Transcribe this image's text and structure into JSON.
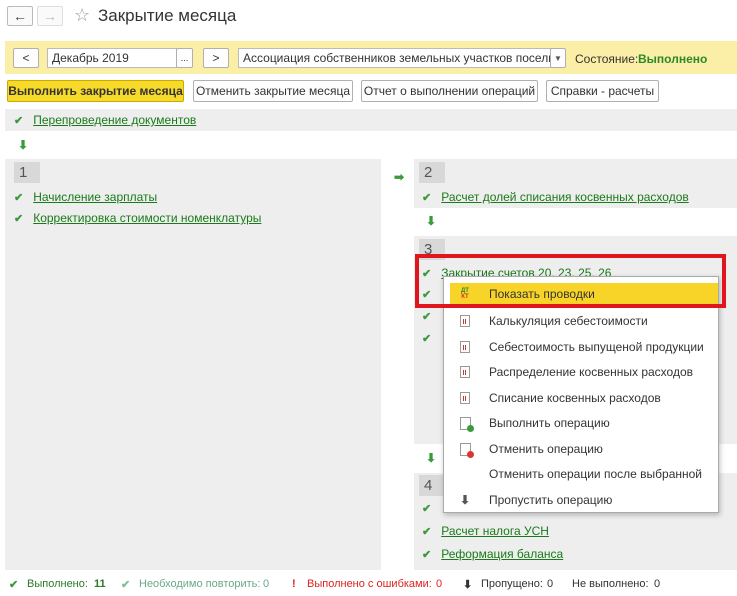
{
  "header": {
    "back_icon": "←",
    "forward_icon": "→",
    "star_icon": "☆",
    "title": "Закрытие месяца"
  },
  "toolbar": {
    "prev_label": "<",
    "period": "Декабрь 2019",
    "ellipsis": "...",
    "next_label": ">",
    "organization": "Ассоциация собственников земельных участков поселка Мел",
    "state_label": "Состояние:",
    "state_value": "Выполнено",
    "state_color": "#2a8a2a"
  },
  "actions": {
    "run": "Выполнить закрытие месяца",
    "cancel": "Отменить закрытие месяца",
    "report": "Отчет о выполнении операций",
    "refs": "Справки - расчеты"
  },
  "pre": {
    "label": "Перепроведение документов"
  },
  "stage1": {
    "num": "1",
    "items": [
      "Начисление зарплаты",
      "Корректировка стоимости номенклатуры"
    ]
  },
  "stage2": {
    "num": "2",
    "items": [
      "Расчет долей списания косвенных расходов"
    ]
  },
  "stage3": {
    "num": "3",
    "items": [
      "Закрытие счетов 20, 23, 25, 26"
    ]
  },
  "stage4": {
    "num": "4",
    "items": [
      "Расчет налога УСН",
      "Реформация баланса"
    ]
  },
  "menu": {
    "items": [
      {
        "label": "Показать проводки",
        "icon": "dt-kt-icon"
      },
      {
        "label": "Калькуляция себестоимости",
        "icon": "report-icon"
      },
      {
        "label": "Себестоимость выпущеной продукции",
        "icon": "report-icon"
      },
      {
        "label": "Распределение косвенных расходов",
        "icon": "report-icon"
      },
      {
        "label": "Списание косвенных расходов",
        "icon": "report-icon"
      },
      {
        "label": "Выполнить операцию",
        "icon": "run-operation-icon"
      },
      {
        "label": "Отменить операцию",
        "icon": "cancel-operation-icon"
      },
      {
        "label": "Отменить операции после выбранной",
        "icon": ""
      },
      {
        "label": "Пропустить операцию",
        "icon": "skip-arrow-icon"
      }
    ]
  },
  "footer": {
    "done_label": "Выполнено:",
    "done_count": "11",
    "repeat_label": "Необходимо повторить:",
    "repeat_count": "0",
    "errors_label": "Выполнено с ошибками:",
    "errors_count": "0",
    "skipped_label": "Пропущено:",
    "skipped_count": "0",
    "notdone_label": "Не выполнено:",
    "notdone_count": "0"
  }
}
